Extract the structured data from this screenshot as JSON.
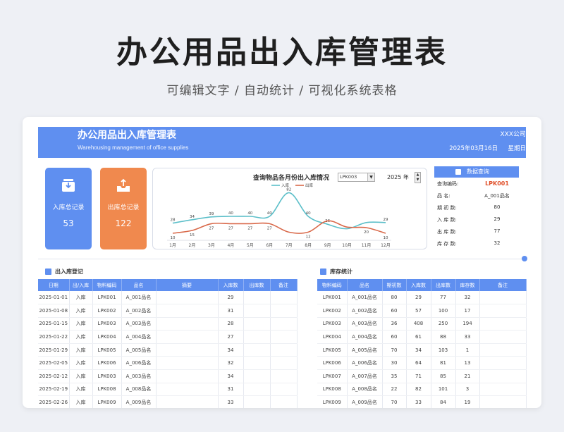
{
  "hero": {
    "title": "办公用品出入库管理表",
    "subtitle": "可编辑文字 / 自动统计 / 可视化系统表格"
  },
  "sheet": {
    "title": "办公用品出入库管理表",
    "subtitle_en": "Warehousing management of office supplies",
    "company": "XXX公司",
    "date": "2025年03月16日",
    "weekday": "星期日"
  },
  "kpi": {
    "in": {
      "label": "入库总记录",
      "value": "53",
      "icon": "inbox-download-icon"
    },
    "out": {
      "label": "出库总记录",
      "value": "122",
      "icon": "inbox-upload-icon"
    }
  },
  "chart": {
    "title": "查询物品各月份出入库情况",
    "select_value": "LPK003",
    "year_label": "2025 年",
    "spinner_up": "▲",
    "spinner_down": "▼",
    "select_arrow": "▼"
  },
  "chart_data": {
    "type": "line",
    "title": "查询物品各月份出入库情况",
    "categories": [
      "1月",
      "2月",
      "3月",
      "4月",
      "5月",
      "6月",
      "7月",
      "8月",
      "9月",
      "10月",
      "11月",
      "12月"
    ],
    "series": [
      {
        "name": "入库",
        "color": "#5cbfc9",
        "values": [
          28,
          34,
          39,
          40,
          40,
          40,
          82,
          40,
          26,
          18,
          29,
          29
        ]
      },
      {
        "name": "出库",
        "color": "#d9694a",
        "values": [
          10,
          15,
          27,
          27,
          27,
          27,
          12,
          12,
          32,
          21,
          20,
          10
        ]
      }
    ],
    "data_labels": {
      "入库": [
        "28",
        "34",
        "39",
        "40",
        "40",
        "40",
        "82",
        "40",
        "26",
        "",
        "",
        "29"
      ],
      "出库": [
        "10",
        "15",
        "27",
        "27",
        "27",
        "27",
        "",
        "12",
        "",
        "",
        "20",
        "10"
      ]
    },
    "ylim": [
      0,
      90
    ],
    "legend_position": "top",
    "grid": false
  },
  "lookup": {
    "header": "数据查询",
    "rows": [
      {
        "key": "查询编码:",
        "value": "LPK001"
      },
      {
        "key": "品    名:",
        "value": "A_001品名"
      },
      {
        "key": "期 初 数:",
        "value": "80"
      },
      {
        "key": "入 库 数:",
        "value": "29"
      },
      {
        "key": "出 库 数:",
        "value": "77"
      },
      {
        "key": "库 存 数:",
        "value": "32"
      }
    ]
  },
  "log": {
    "title": "出入库登记",
    "headers": [
      "日期",
      "出/入库",
      "物料编码",
      "品名",
      "摘要",
      "入库数",
      "出库数",
      "备注"
    ],
    "rows": [
      [
        "2025-01-01",
        "入库",
        "LPK001",
        "A_001品名",
        "",
        "29",
        "",
        ""
      ],
      [
        "2025-01-08",
        "入库",
        "LPK002",
        "A_002品名",
        "",
        "31",
        "",
        ""
      ],
      [
        "2025-01-15",
        "入库",
        "LPK003",
        "A_003品名",
        "",
        "28",
        "",
        ""
      ],
      [
        "2025-01-22",
        "入库",
        "LPK004",
        "A_004品名",
        "",
        "27",
        "",
        ""
      ],
      [
        "2025-01-29",
        "入库",
        "LPK005",
        "A_005品名",
        "",
        "34",
        "",
        ""
      ],
      [
        "2025-02-05",
        "入库",
        "LPK006",
        "A_006品名",
        "",
        "32",
        "",
        ""
      ],
      [
        "2025-02-12",
        "入库",
        "LPK003",
        "A_003品名",
        "",
        "34",
        "",
        ""
      ],
      [
        "2025-02-19",
        "入库",
        "LPK008",
        "A_008品名",
        "",
        "31",
        "",
        ""
      ],
      [
        "2025-02-26",
        "入库",
        "LPK009",
        "A_009品名",
        "",
        "33",
        "",
        ""
      ]
    ]
  },
  "stock": {
    "title": "库存统计",
    "headers": [
      "物料编码",
      "品名",
      "期初数",
      "入库数",
      "出库数",
      "库存数",
      "备注"
    ],
    "rows": [
      [
        "LPK001",
        "A_001品名",
        "80",
        "29",
        "77",
        "32",
        ""
      ],
      [
        "LPK002",
        "A_002品名",
        "60",
        "57",
        "100",
        "17",
        ""
      ],
      [
        "LPK003",
        "A_003品名",
        "36",
        "408",
        "250",
        "194",
        ""
      ],
      [
        "LPK004",
        "A_004品名",
        "60",
        "61",
        "88",
        "33",
        ""
      ],
      [
        "LPK005",
        "A_005品名",
        "70",
        "34",
        "103",
        "1",
        ""
      ],
      [
        "LPK006",
        "A_006品名",
        "30",
        "64",
        "81",
        "13",
        ""
      ],
      [
        "LPK007",
        "A_007品名",
        "35",
        "71",
        "85",
        "21",
        ""
      ],
      [
        "LPK008",
        "A_008品名",
        "22",
        "82",
        "101",
        "3",
        ""
      ],
      [
        "LPK009",
        "A_009品名",
        "70",
        "33",
        "84",
        "19",
        ""
      ]
    ]
  },
  "colors": {
    "accent": "#5f8ff0",
    "orange": "#f0894e",
    "highlight": "#e0502a"
  }
}
